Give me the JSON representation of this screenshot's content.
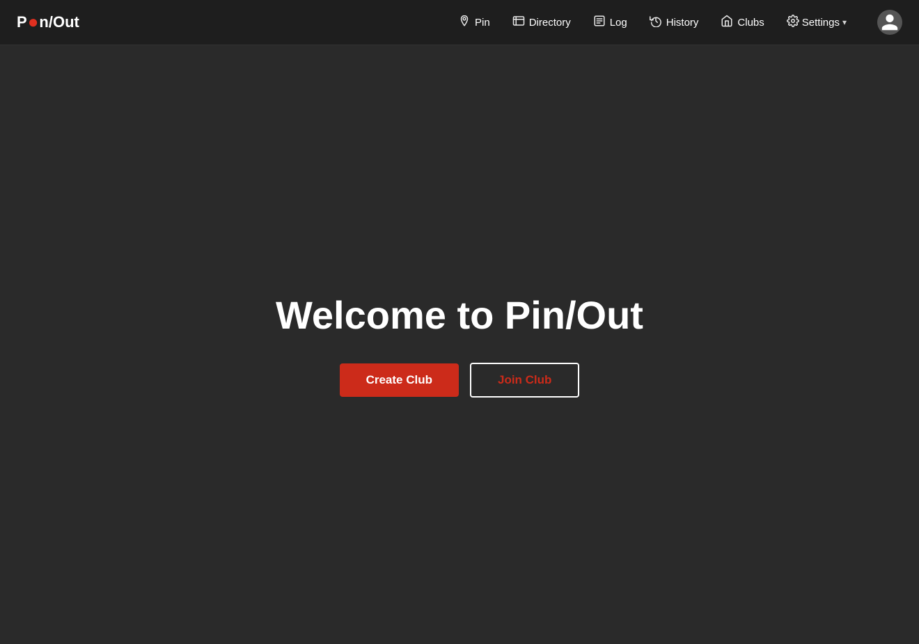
{
  "app": {
    "logo_prefix": "P",
    "logo_pin": "i",
    "logo_suffix": "n/Out"
  },
  "nav": {
    "items": [
      {
        "id": "pin",
        "label": "Pin"
      },
      {
        "id": "directory",
        "label": "Directory"
      },
      {
        "id": "log",
        "label": "Log"
      },
      {
        "id": "history",
        "label": "History"
      },
      {
        "id": "clubs",
        "label": "Clubs"
      }
    ],
    "settings_label": "Settings",
    "chevron": "▾"
  },
  "main": {
    "welcome_title": "Welcome to Pin/Out",
    "create_button": "Create Club",
    "join_button": "Join Club"
  }
}
